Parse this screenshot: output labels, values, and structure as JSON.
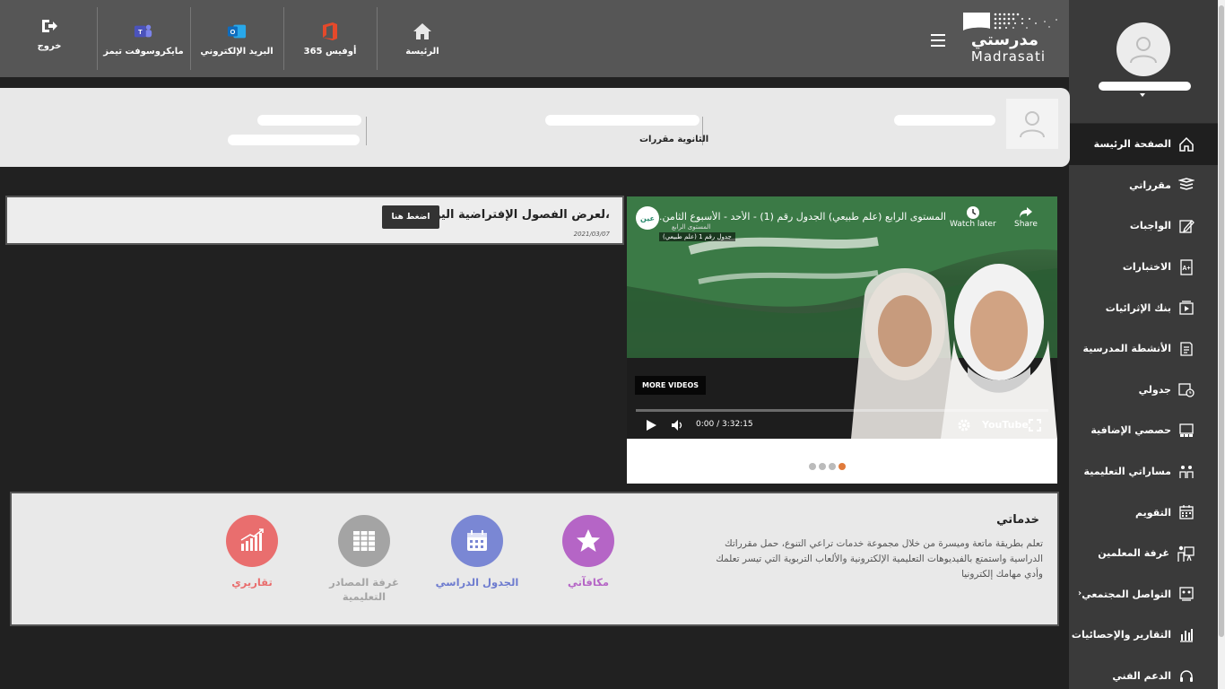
{
  "topbar": {
    "items": [
      {
        "label": "الرئيسة",
        "icon": "home-icon"
      },
      {
        "label": "أوفيس 365",
        "icon": "office365-icon"
      },
      {
        "label": "البريد الإلكتروني",
        "icon": "outlook-icon"
      },
      {
        "label": "مايكروسوفت تيمز",
        "icon": "teams-icon"
      },
      {
        "label": "خروج",
        "icon": "logout-icon"
      }
    ],
    "logo_text": "مدرستي",
    "logo_latin": "Madrasati"
  },
  "sidebar": {
    "items": [
      {
        "label": "الصفحة الرئيسة",
        "icon": "home-icon",
        "active": true
      },
      {
        "label": "مقرراتي",
        "icon": "books-icon"
      },
      {
        "label": "الواجبات",
        "icon": "edit-icon"
      },
      {
        "label": "الاختبارات",
        "icon": "exam-icon"
      },
      {
        "label": "بنك الإثرائيات",
        "icon": "video-bank-icon"
      },
      {
        "label": "الأنشطة المدرسية",
        "icon": "activities-icon"
      },
      {
        "label": "جدولي",
        "icon": "calendar-clock-icon"
      },
      {
        "label": "حصصي الإضافية",
        "icon": "extra-classes-icon"
      },
      {
        "label": "مساراتي التعليمية",
        "icon": "paths-icon"
      },
      {
        "label": "التقويم",
        "icon": "calendar-icon"
      },
      {
        "label": "غرفة المعلمين",
        "icon": "teacher-icon"
      },
      {
        "label": "التواصل المجتمعي",
        "icon": "community-icon"
      },
      {
        "label": "التقارير والإحصائيات",
        "icon": "reports-icon"
      },
      {
        "label": "الدعم الفني",
        "icon": "support-icon"
      }
    ]
  },
  "profile_card": {
    "stage_label": "الثانوية مقررات"
  },
  "announcement": {
    "title": "لعرض الفصول الإفتراضية اليومية،",
    "button_label": "اضغط هنا",
    "date": "2021/03/07"
  },
  "video": {
    "title": "المستوى الرابع (علم طبيعي) الجدول رقم (1) - الأحد - الأسبوع الثامن...",
    "subtitle1": "المستوى الرابع",
    "subtitle2": "(علم طبيعي) جدول رقم 1",
    "watch_later": "Watch later",
    "share": "Share",
    "more_videos": "MORE VIDEOS",
    "time": "0:00 / 3:32:15",
    "youtube": "YouTube",
    "channel_badge": "عين",
    "slides": 4,
    "active_slide": 4
  },
  "services": {
    "title": "خدماتي",
    "description": "تعلم بطريقة ماتعة وميسرة من خلال مجموعة خدمات تراعي التنوع، حمل مقرراتك الدراسية واستمتع بالفيديوهات التعليمية الإلكترونية والألعاب التربوية التي تيسر تعلمك وأدي مهامك إلكترونيا",
    "tiles": [
      {
        "label": "مكافآتي",
        "color": "#b565c6",
        "icon": "star-icon"
      },
      {
        "label": "الجدول الدراسي",
        "color": "#7a87d4",
        "icon": "calendar-icon"
      },
      {
        "label": "غرفة المصادر التعليمية",
        "color": "#a4a4a4",
        "icon": "bookshelf-icon"
      },
      {
        "label": "تقاريري",
        "color": "#e96e6e",
        "icon": "chart-icon"
      }
    ]
  }
}
